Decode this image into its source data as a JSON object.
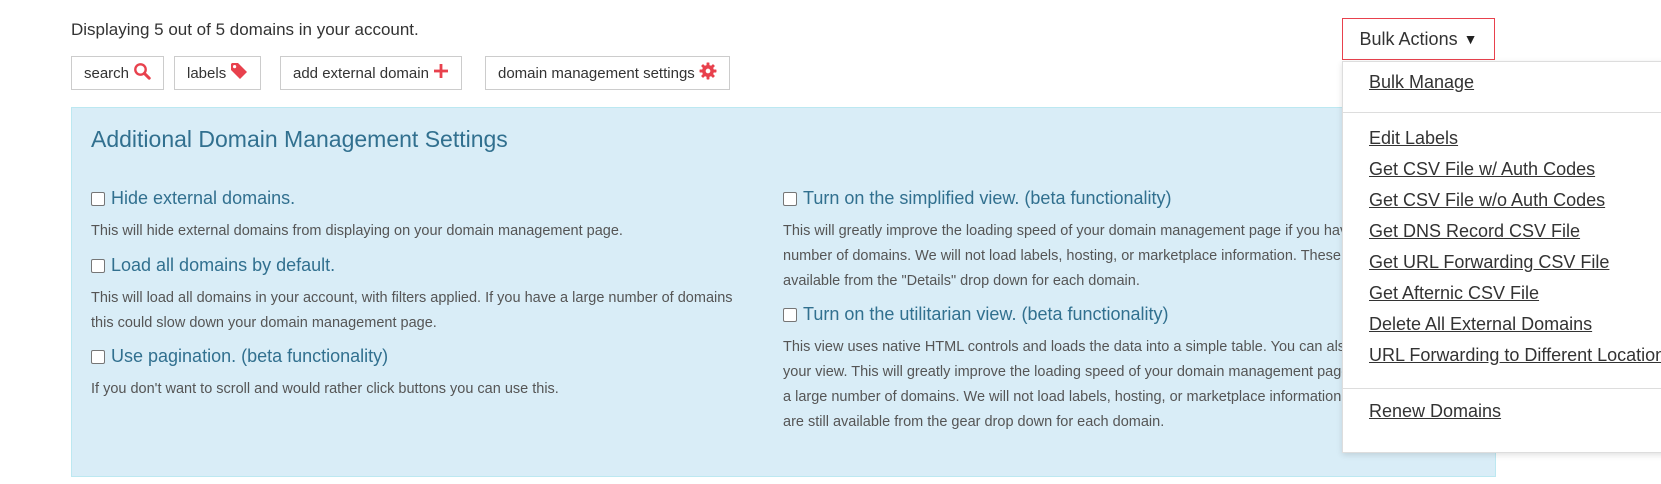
{
  "summary": "Displaying 5 out of 5 domains in your account.",
  "toolbar": {
    "search": "search",
    "labels": "labels",
    "add_external": "add external domain",
    "settings": "domain management settings"
  },
  "bulk_actions": {
    "label": "Bulk Actions",
    "arrow": "▼",
    "groups": [
      [
        "Bulk Manage"
      ],
      [
        "Edit Labels",
        "Get CSV File w/ Auth Codes",
        "Get CSV File w/o Auth Codes",
        "Get DNS Record CSV File",
        "Get URL Forwarding CSV File",
        "Get Afternic CSV File",
        "Delete All External Domains",
        "URL Forwarding to Different Location"
      ],
      [
        "Renew Domains"
      ]
    ]
  },
  "panel": {
    "title": "Additional Domain Management Settings",
    "left_options": [
      {
        "label": "Hide external domains.",
        "desc": "This will hide external domains from displaying on your domain management page.",
        "checked": false
      },
      {
        "label": "Load all domains by default.",
        "desc": "This will load all domains in your account, with filters applied. If you have a large number of domains this could slow down your domain management page.",
        "checked": false
      },
      {
        "label": "Use pagination. (beta functionality)",
        "desc": "If you don't want to scroll and would rather click buttons you can use this.",
        "checked": false
      }
    ],
    "right_options": [
      {
        "label": "Turn on the simplified view. (beta functionality)",
        "desc": "This will greatly improve the loading speed of your domain management page if you have a large number of domains. We will not load labels, hosting, or marketplace information. These items are still available from the \"Details\" drop down for each domain.",
        "checked": false
      },
      {
        "label": "Turn on the utilitarian view. (beta functionality)",
        "desc": "This view uses native HTML controls and loads the data into a simple table. You can also customize your view. This will greatly improve the loading speed of your domain management page if you have a large number of domains. We will not load labels, hosting, or marketplace information. These items are still available from the gear drop down for each domain.",
        "checked": false
      }
    ]
  },
  "colors": {
    "accent": "#e8414d",
    "panel_bg": "#d9edf7",
    "panel_text": "#31708f"
  },
  "icons": {
    "search": "search-icon",
    "labels": "tag-icon",
    "add": "plus-icon",
    "settings": "gear-icon"
  }
}
